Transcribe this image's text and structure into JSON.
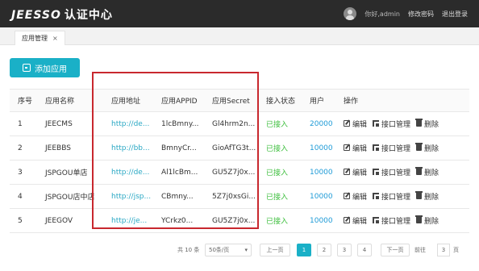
{
  "header": {
    "brand": "JEESSO",
    "brand_sub": "认证中心",
    "greeting": "你好,admin",
    "change_password": "修改密码",
    "logout": "退出登录"
  },
  "tabs": [
    {
      "label": "应用管理",
      "close": "×"
    }
  ],
  "add_button": "添加应用",
  "table": {
    "columns": [
      "序号",
      "应用名称",
      "应用地址",
      "应用APPID",
      "应用Secret",
      "接入状态",
      "用户",
      "操作"
    ],
    "rows": [
      {
        "no": "1",
        "name": "JEECMS",
        "url": "http://de...",
        "appid": "1lcBmny...",
        "secret": "Gl4hrm2n...",
        "status": "已接入",
        "users": "20000"
      },
      {
        "no": "2",
        "name": "JEEBBS",
        "url": "http://bb...",
        "appid": "BmnyCr...",
        "secret": "GioAfTG3t...",
        "status": "已接入",
        "users": "10000"
      },
      {
        "no": "3",
        "name": "JSPGOU单店",
        "url": "http://de...",
        "appid": "Al1lcBm...",
        "secret": "GU5Z7j0x...",
        "status": "已接入",
        "users": "10000"
      },
      {
        "no": "4",
        "name": "JSPGOU店中店",
        "url": "http://jsp...",
        "appid": "CBmny...",
        "secret": "5Z7j0xsGi...",
        "status": "已接入",
        "users": "10000"
      },
      {
        "no": "5",
        "name": "JEEGOV",
        "url": "http://je...",
        "appid": "YCrkz0...",
        "secret": "GU5Z7j0x...",
        "status": "已接入",
        "users": "10000"
      }
    ],
    "actions": {
      "edit": "编辑",
      "api": "接口管理",
      "delete": "删除"
    }
  },
  "pagination": {
    "total": "共 10 条",
    "page_size": "50条/页",
    "prev": "上一页",
    "pages": [
      "1",
      "2",
      "3",
      "4"
    ],
    "current": "1",
    "next": "下一页",
    "jump_label": "前往",
    "jump_value": "3",
    "jump_unit": "页"
  },
  "colors": {
    "accent": "#1ab0c7",
    "header_bg": "#2b2b2b",
    "highlight": "#c8282e",
    "status_ok": "#3fbf3f"
  }
}
